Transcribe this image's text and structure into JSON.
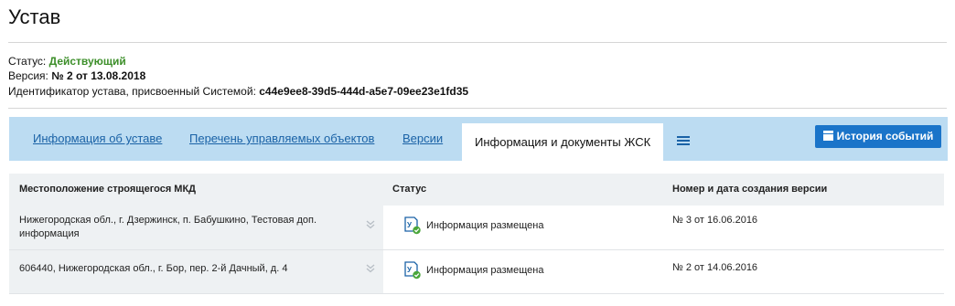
{
  "page": {
    "title": "Устав"
  },
  "meta": {
    "status_label": "Статус:",
    "status_value": "Действующий",
    "status_color": "#3d8f2a",
    "version_label": "Версия:",
    "version_value": "№ 2 от 13.08.2018",
    "id_label": "Идентификатор устава, присвоенный Системой:",
    "id_value": "c44e9ee8-39d5-444d-a5e7-09ee23e1fd35"
  },
  "tabs": [
    {
      "label": "Информация об уставе",
      "active": false
    },
    {
      "label": "Перечень управляемых объектов",
      "active": false
    },
    {
      "label": "Версии",
      "active": false
    },
    {
      "label": "Информация и документы ЖСК",
      "active": true
    }
  ],
  "toolbar": {
    "menu_icon": "list-menu-icon",
    "history_label": "История событий",
    "history_icon": "calendar-icon",
    "accent_color": "#1a74c9"
  },
  "table": {
    "columns": [
      "Местоположение строящегося МКД",
      "Статус",
      "Номер и дата создания версии"
    ],
    "rows": [
      {
        "location": "Нижегородская обл., г. Дзержинск, п. Бабушкино, Тестовая доп. информация",
        "status": "Информация размещена",
        "status_icon": "document-check-icon",
        "version": "№ 3 от 16.06.2016"
      },
      {
        "location": "606440, Нижегородская обл., г. Бор, пер. 2-й Дачный, д. 4",
        "status": "Информация размещена",
        "status_icon": "document-check-icon",
        "version": "№ 2 от 14.06.2016"
      }
    ]
  }
}
